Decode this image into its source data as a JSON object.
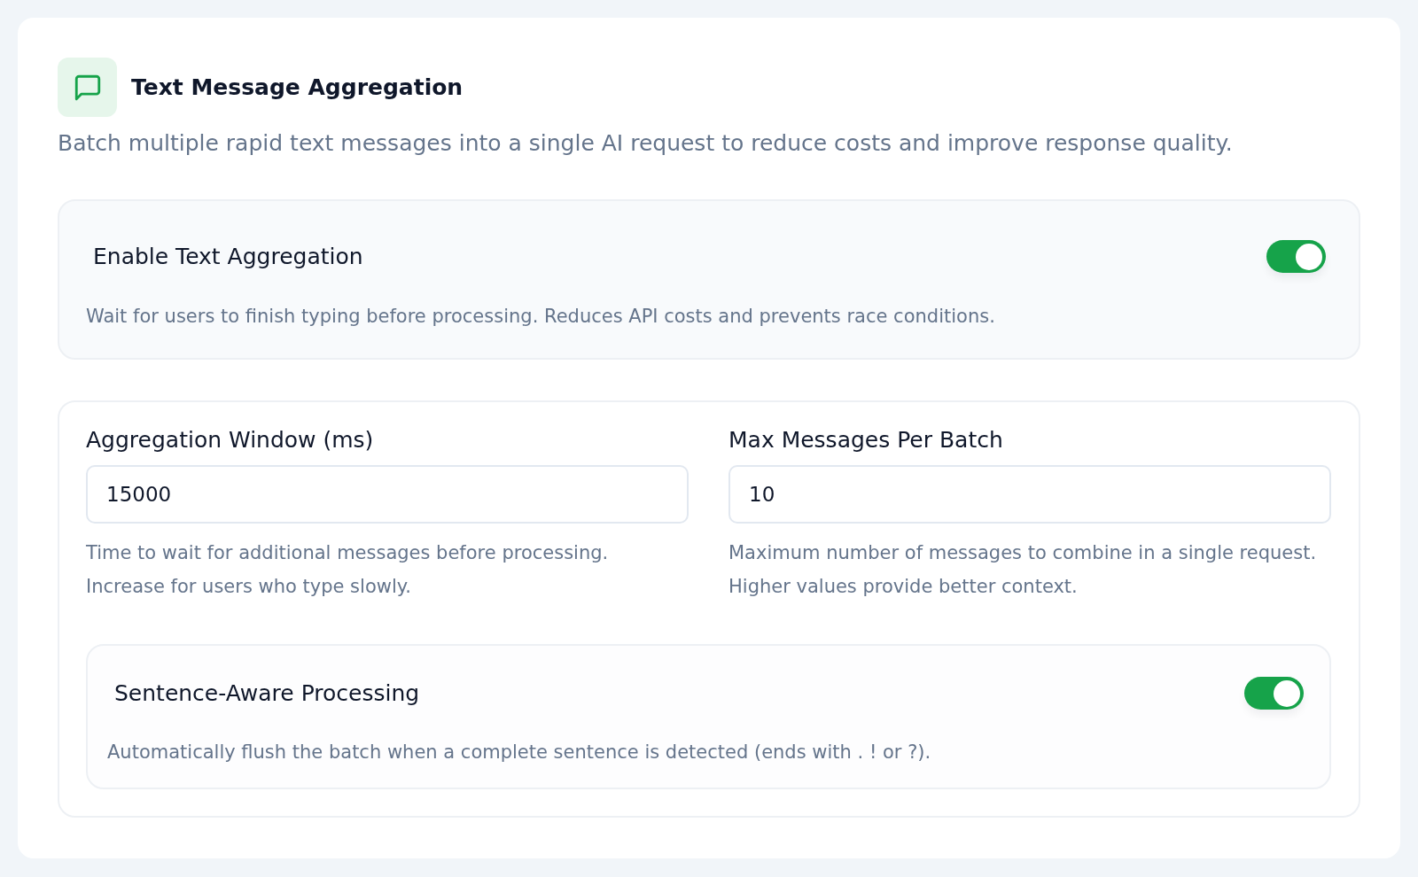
{
  "header": {
    "title": "Text Message Aggregation",
    "description": "Batch multiple rapid text messages into a single AI request to reduce costs and improve response quality."
  },
  "enable": {
    "label": "Enable Text Aggregation",
    "on": true,
    "description": "Wait for users to finish typing before processing. Reduces API costs and prevents race conditions."
  },
  "fields": [
    {
      "label": "Aggregation Window (ms)",
      "value": "15000",
      "help": "Time to wait for additional messages before processing. Increase for users who type slowly."
    },
    {
      "label": "Max Messages Per Batch",
      "value": "10",
      "help": "Maximum number of messages to combine in a single request. Higher values provide better context."
    }
  ],
  "sentence_aware": {
    "label": "Sentence-Aware Processing",
    "on": true,
    "description": "Automatically flush the batch when a complete sentence is detected (ends with . ! or ?)."
  }
}
